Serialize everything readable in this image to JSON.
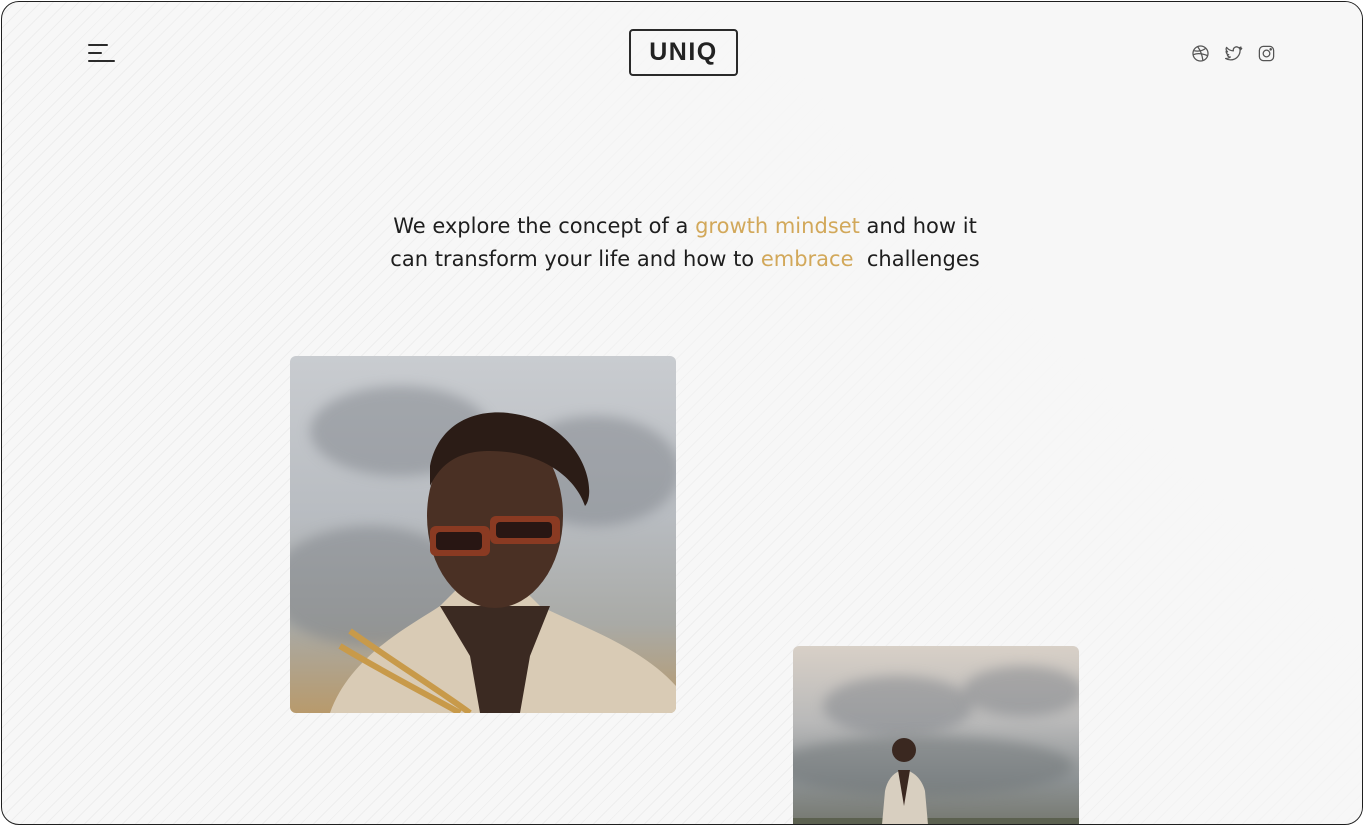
{
  "header": {
    "logo": "UNIQ",
    "menu_icon": "hamburger-menu-icon",
    "social_icons": [
      "dribbble-icon",
      "twitter-icon",
      "instagram-icon"
    ]
  },
  "headline": {
    "part1": "We explore the concept of a ",
    "highlight1": "growth mindset",
    "part2": " and how it can transform your life and how to ",
    "highlight2": "embrace",
    "part3": "  challenges"
  },
  "images": [
    {
      "name": "portrait-sunglasses-photo"
    },
    {
      "name": "man-in-field-photo"
    }
  ],
  "colors": {
    "accent": "#d2a85a",
    "text": "#1e1e1e",
    "background": "#f7f7f7"
  }
}
